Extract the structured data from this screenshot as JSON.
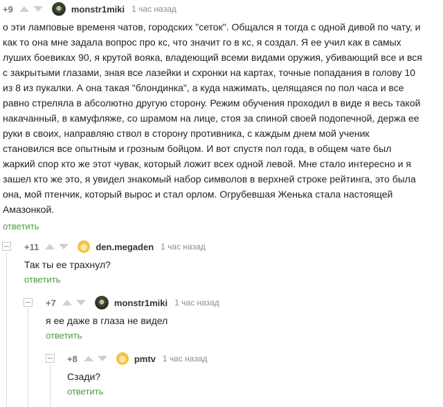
{
  "comments": [
    {
      "rating": "+9",
      "author": "monstr1miki",
      "time": "1 час назад",
      "avatar_icon": "tank-avatar",
      "lines": [
        "о эти ламповые временя чатов, городских \"сеток\". Общался я тогда с одной дивой по чату, и",
        "как то она мне задала вопрос про кс, что значит го в кс, я создал. Я ее учил как в самых",
        "луших боевиках 90, я крутой вояка, владеющий всеми видами оружия, убивающий все и вся",
        "с закрытыми глазами, зная все лазейки и схронки на картах, точные попадания в голову 10",
        "из 8 из пукалки. А она такая \"блондинка\",  а куда нажимать, целящаяся по пол часа и все",
        "равно стреляла в абсолютно другую сторону. Режим обучения проходил в виде я весь такой",
        "накачанный, в камуфляже, со шрамом на лице, стоя за спиной своей подопечной, держа ее",
        "руки в своих, направляю ствол в сторону противника, с каждым днем мой ученик",
        "становился все опытным и грозным бойцом.  И вот спустя пол года, в общем чате был",
        "жаркий спор кто же этот чувак, который ложит всех одной левой. Мне стало интересно и я",
        "зашел кто же это, я увидел знакомый набор символов в верхней строке рейтинга, это была",
        "она, мой птенчик, который вырос и стал орлом. Огрубевшая Женька стала настоящей",
        "Амазонкой."
      ],
      "reply_label": "ответить"
    },
    {
      "rating": "+11",
      "author": "den.megaden",
      "time": "1 час назад",
      "avatar_icon": "emoji-avatar",
      "lines": [
        "Так ты ее трахнул?"
      ],
      "reply_label": "ответить"
    },
    {
      "rating": "+7",
      "author": "monstr1miki",
      "time": "1 час назад",
      "avatar_icon": "tank-avatar",
      "lines": [
        "я ее даже в глаза не видел"
      ],
      "reply_label": "ответить"
    },
    {
      "rating": "+8",
      "author": "pmtv",
      "time": "1 час назад",
      "avatar_icon": "emoji-avatar",
      "lines": [
        "Сзади?"
      ],
      "reply_label": "ответить"
    }
  ]
}
